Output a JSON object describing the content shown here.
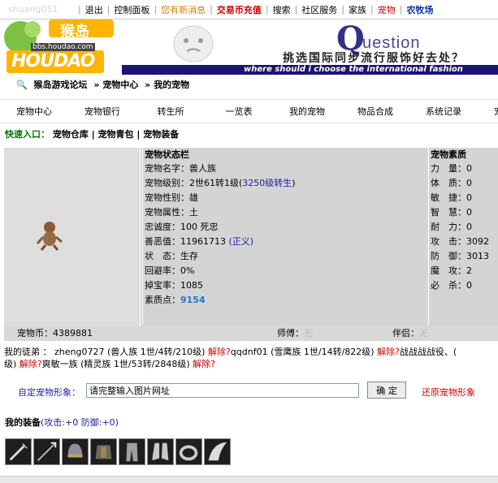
{
  "topbar": {
    "username": "shuang051",
    "items": [
      {
        "label": "退出",
        "style": "normal"
      },
      {
        "label": "控制面板",
        "style": "normal"
      },
      {
        "label": "您有新消息",
        "style": "orange"
      },
      {
        "label": "交易币充值",
        "style": "red-bold"
      },
      {
        "label": "搜索",
        "style": "normal"
      },
      {
        "label": "社区服务",
        "style": "normal"
      },
      {
        "label": "家族",
        "style": "normal"
      },
      {
        "label": "宠物",
        "style": "red"
      },
      {
        "label": "农牧场",
        "style": "blue-bold"
      }
    ]
  },
  "header": {
    "logo_text": "HOUDAO",
    "logo_chinese": "猴岛",
    "logo_url_text": "bbs.houdao.com",
    "banner_q": "Q",
    "banner_question": "uestion",
    "banner_tagline": "挑选国际同步流行服饰好去处？",
    "banner_english": "where should i choose the international fashion"
  },
  "breadcrumb": [
    "猴岛游戏论坛",
    "» 宠物中心",
    "» 我的宠物"
  ],
  "menu": [
    "宠物中心",
    "宠物银行",
    "转生所",
    "一览表",
    "我的宠物",
    "物品合成",
    "系统记录",
    "宠物家族"
  ],
  "quick_entry": {
    "label": "快速入口：",
    "links": [
      "宠物仓库",
      "宠物青包",
      "宠物装备"
    ]
  },
  "status": {
    "title": "宠物状态栏",
    "name_label": "宠物名字：",
    "name": "兽人族",
    "level_label": "宠物级别：",
    "level": "2世61转1级(",
    "level_link": "3250级转生",
    "level_end": ")",
    "gender_label": "宠物性别：",
    "gender": "雄",
    "attr_label": "宠物属性：",
    "attr": "土",
    "loyalty_label": "忠诚度：",
    "loyalty": "100 死忠",
    "evil_label": "善恶值：",
    "evil": "11961713",
    "evil_link": "(正义)",
    "state_label": "状　态：",
    "state": "生存",
    "dodge_label": "回避率：",
    "dodge": "0%",
    "drop_label": "掉宝率：",
    "drop": "1085",
    "points_label": "素质点：",
    "points": "9154"
  },
  "quality": {
    "title": "宠物素质",
    "rows": [
      {
        "label": "力　量：",
        "value": "0"
      },
      {
        "label": "体　质：",
        "value": "0"
      },
      {
        "label": "敏　捷：",
        "value": "0"
      },
      {
        "label": "智　慧：",
        "value": "0"
      },
      {
        "label": "耐　力：",
        "value": "0"
      },
      {
        "label": "攻　击：",
        "value": "3092"
      },
      {
        "label": "防　御：",
        "value": "3013"
      },
      {
        "label": "魔　攻：",
        "value": "2"
      },
      {
        "label": "必　杀：",
        "value": "0"
      }
    ]
  },
  "bottom_info": {
    "coin_label": "宠物币：",
    "coin": "4389881",
    "master_label": "师傅：",
    "master": "无",
    "partner_label": "伴侣：",
    "partner": "无"
  },
  "apprentices": {
    "label": "我的徒弟 ：",
    "line1_a": "zheng0727 (兽人族 1世/4转/210级)",
    "remove1": "解除?",
    "line1_b": "qqdnf01 (雪鹰族 1世/14转/822级)",
    "remove2": "解除?",
    "line1_c": "战战战战役、(",
    "line2_a": "级)",
    "remove3": "解除?",
    "line2_b": "爽敏一族 (精灵族 1世/53转/2848级)",
    "remove4": "解除?"
  },
  "custom": {
    "label": "自定宠物形象：",
    "input_value": "请完整输入图片网址",
    "confirm": "确 定",
    "restore": "还原宠物形象"
  },
  "equipment": {
    "title": "我的装备",
    "stats": "(攻击:+0 防御:+0)",
    "items": [
      "sword-icon",
      "spear-icon",
      "helmet-icon",
      "armor-icon",
      "pants-icon",
      "boots-icon",
      "ring-icon",
      "wing-icon"
    ]
  }
}
